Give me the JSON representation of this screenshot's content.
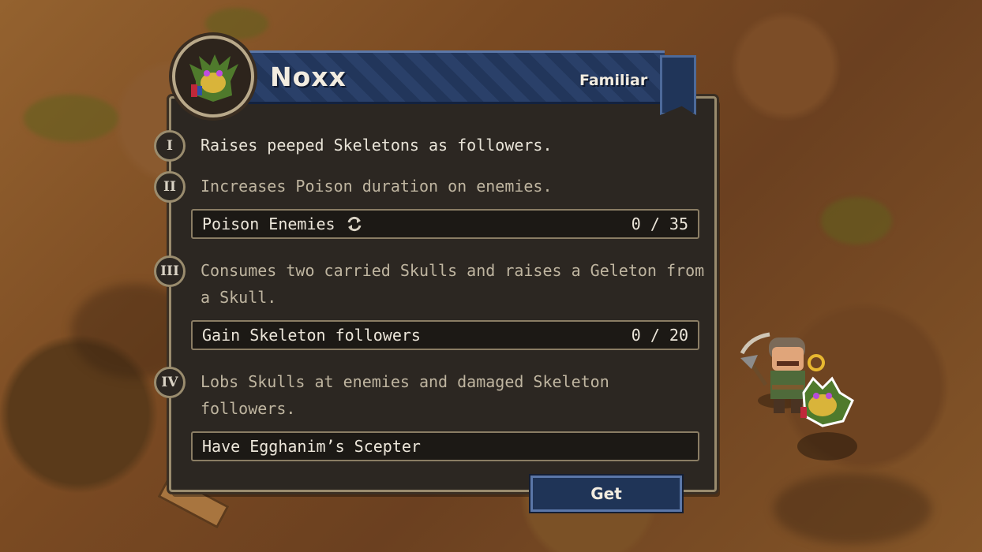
{
  "familiar": {
    "name": "Noxx",
    "type": "Familiar"
  },
  "abilities": [
    {
      "numeral": "I",
      "text": "Raises peeped Skeletons as followers."
    },
    {
      "numeral": "II",
      "text": "Increases Poison duration on enemies."
    },
    {
      "numeral": "III",
      "text": "Consumes two carried Skulls and raises a Geleton from a Skull."
    },
    {
      "numeral": "IV",
      "text": "Lobs Skulls at enemies and damaged Skeleton followers."
    }
  ],
  "quests": [
    {
      "label": "Poison Enemies",
      "icon": "repeat-icon",
      "progress": "0 / 35",
      "current": 0,
      "total": 35
    },
    {
      "label": "Gain Skeleton followers",
      "progress": "0 / 20",
      "current": 0,
      "total": 20
    },
    {
      "label": "Have Egghanim’s Scepter"
    }
  ],
  "actions": {
    "get_label": "Get"
  },
  "colors": {
    "panel": "#2c2722",
    "header": "#2a4069",
    "border": "#9a8c6e",
    "text": "#e9e4d8"
  }
}
